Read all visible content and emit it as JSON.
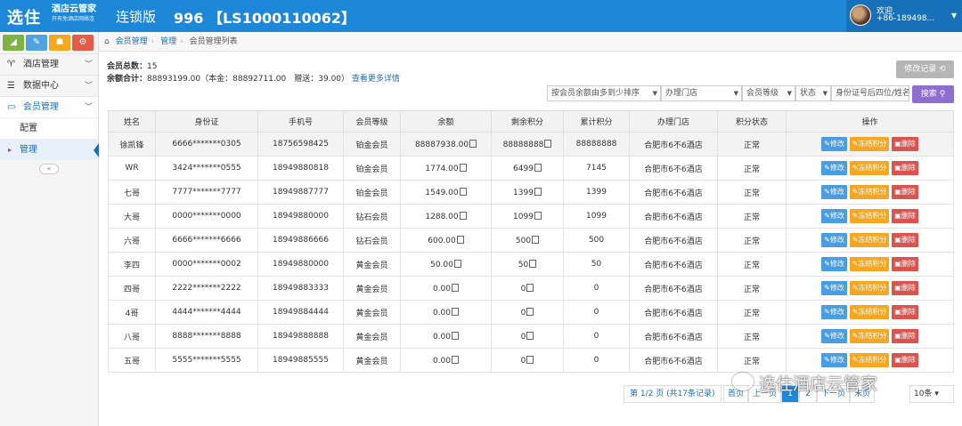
{
  "header": {
    "brand": "选住",
    "brand_sub1": "酒店云管家",
    "brand_sub2": "开有免酒店网络连",
    "edition": "连锁版",
    "store": "996 【LS1000110062】",
    "user_welcome": "欢迎,",
    "user_phone": "+86-189498..."
  },
  "sidebar": {
    "menu": [
      {
        "label": "酒店管理",
        "icon": "utensils-icon"
      },
      {
        "label": "数据中心",
        "icon": "database-icon"
      },
      {
        "label": "会员管理",
        "icon": "card-icon"
      }
    ],
    "sub": [
      "配置",
      "管理"
    ]
  },
  "breadcrumb": {
    "items": [
      "会员管理",
      "管理",
      "会员管理列表"
    ]
  },
  "summary": {
    "total_label": "会员总数：",
    "total_value": "15",
    "balance_label": "余额合计：",
    "balance_value": "88893199.00（本金：88892711.00　赠送：39.00）",
    "more_link": "查看更多详情"
  },
  "buttons": {
    "history": "修改记录",
    "search": "搜索"
  },
  "filters": {
    "sort": "按会员余额由多到少排序",
    "store": "办理门店",
    "level": "会员等级",
    "status": "状态",
    "id_placeholder": "身份证号后四位/姓名"
  },
  "table": {
    "headers": [
      "姓名",
      "身份证",
      "手机号",
      "会员等级",
      "余额",
      "剩余积分",
      "累计积分",
      "办理门店",
      "积分状态",
      "操作"
    ],
    "rows": [
      [
        "徐凯锋",
        "6666*******0305",
        "18756598425",
        "铂金会员",
        "88887938.00",
        "88888888",
        "88888888",
        "合肥市6不6酒店",
        "正常"
      ],
      [
        "WR",
        "3424*******0555",
        "18949880818",
        "铂金会员",
        "1774.00",
        "6499",
        "7145",
        "合肥市6不6酒店",
        "正常"
      ],
      [
        "七哥",
        "7777*******7777",
        "18949887777",
        "铂金会员",
        "1549.00",
        "1399",
        "1399",
        "合肥市6不6酒店",
        "正常"
      ],
      [
        "大哥",
        "0000*******0000",
        "18949880000",
        "钻石会员",
        "1288.00",
        "1099",
        "1099",
        "合肥市6不6酒店",
        "正常"
      ],
      [
        "六哥",
        "6666*******6666",
        "18949886666",
        "钻石会员",
        "600.00",
        "500",
        "500",
        "合肥市6不6酒店",
        "正常"
      ],
      [
        "李四",
        "0000*******0002",
        "18949880000",
        "黄金会员",
        "50.00",
        "50",
        "50",
        "合肥市6不6酒店",
        "正常"
      ],
      [
        "四哥",
        "2222*******2222",
        "18949883333",
        "黄金会员",
        "0.00",
        "0",
        "0",
        "合肥市6不6酒店",
        "正常"
      ],
      [
        "4哥",
        "4444*******4444",
        "18949884444",
        "黄金会员",
        "0.00",
        "0",
        "0",
        "合肥市6不6酒店",
        "正常"
      ],
      [
        "八哥",
        "8888*******8888",
        "18949888888",
        "黄金会员",
        "0.00",
        "0",
        "0",
        "合肥市6不6酒店",
        "正常"
      ],
      [
        "五哥",
        "5555*******5555",
        "18949885555",
        "黄金会员",
        "0.00",
        "0",
        "0",
        "合肥市6不6酒店",
        "正常"
      ]
    ],
    "ops": {
      "edit": "修改",
      "freeze": "冻结积分",
      "delete": "删除"
    }
  },
  "pagination": {
    "info": "第 1/2 页 (共17条记录)",
    "pages": [
      "首页",
      "上一页",
      "1",
      "2",
      "下一页",
      "末页"
    ],
    "current": "1",
    "page_size": "10条"
  },
  "watermark": "选住酒店云管家"
}
